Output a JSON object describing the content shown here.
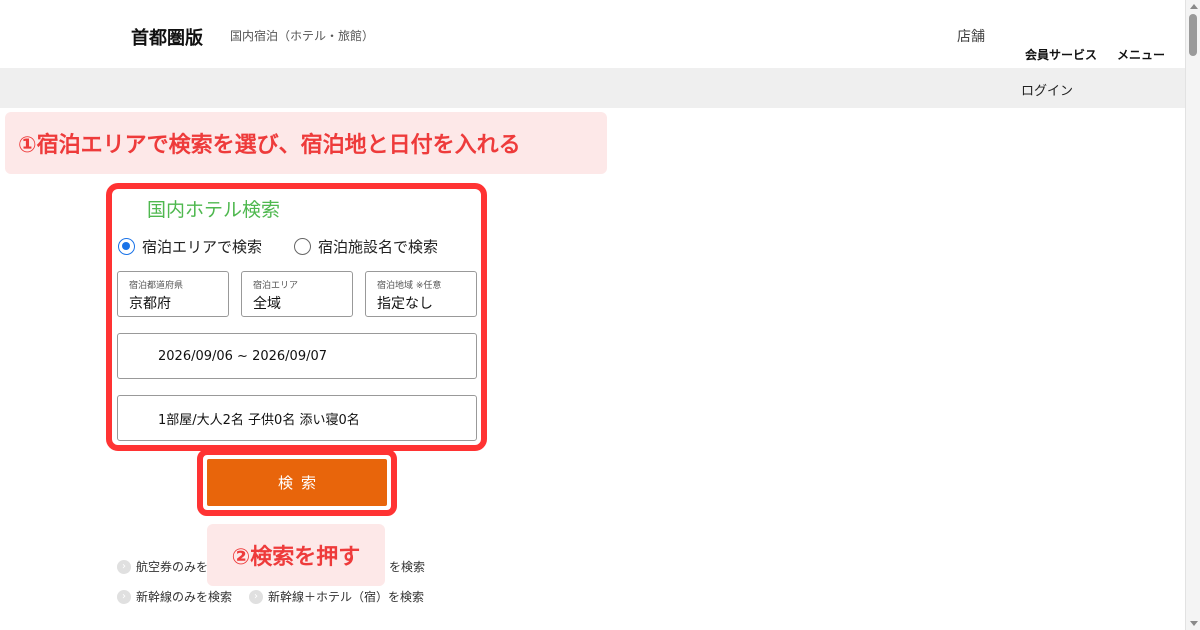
{
  "header": {
    "brand": "首都圏版",
    "category": "国内宿泊（ホテル・旅館）",
    "store_link": "店舗",
    "member_service": "会員サービス",
    "menu": "メニュー",
    "login": "ログイン"
  },
  "annotations": {
    "step1": "①宿泊エリアで検索を選び、宿泊地と日付を入れる",
    "step2": "②検索を押す"
  },
  "search_panel": {
    "title": "国内ホテル検索",
    "radio_area": "宿泊エリアで検索",
    "radio_area_checked": true,
    "radio_facility": "宿泊施設名で検索",
    "prefecture": {
      "label": "宿泊都道府県",
      "value": "京都府"
    },
    "area": {
      "label": "宿泊エリア",
      "value": "全域"
    },
    "district": {
      "label": "宿泊地域 ※任意",
      "value": "指定なし"
    },
    "dates": "2026/09/06 ~ 2026/09/07",
    "guests": "1部屋/大人2名 子供0名 添い寝0名",
    "search_button": "検索"
  },
  "other_searches": [
    {
      "label": "航空券のみを"
    },
    {
      "label": "を検索"
    },
    {
      "label": "新幹線のみを検索"
    },
    {
      "label": "新幹線＋ホテル（宿）を検索"
    }
  ],
  "colors": {
    "annotation_red": "#ee3b3b",
    "highlight_border": "#ff3333",
    "search_button": "#e8650b",
    "title_green": "#4fb84f",
    "radio_blue": "#1a73e8"
  }
}
